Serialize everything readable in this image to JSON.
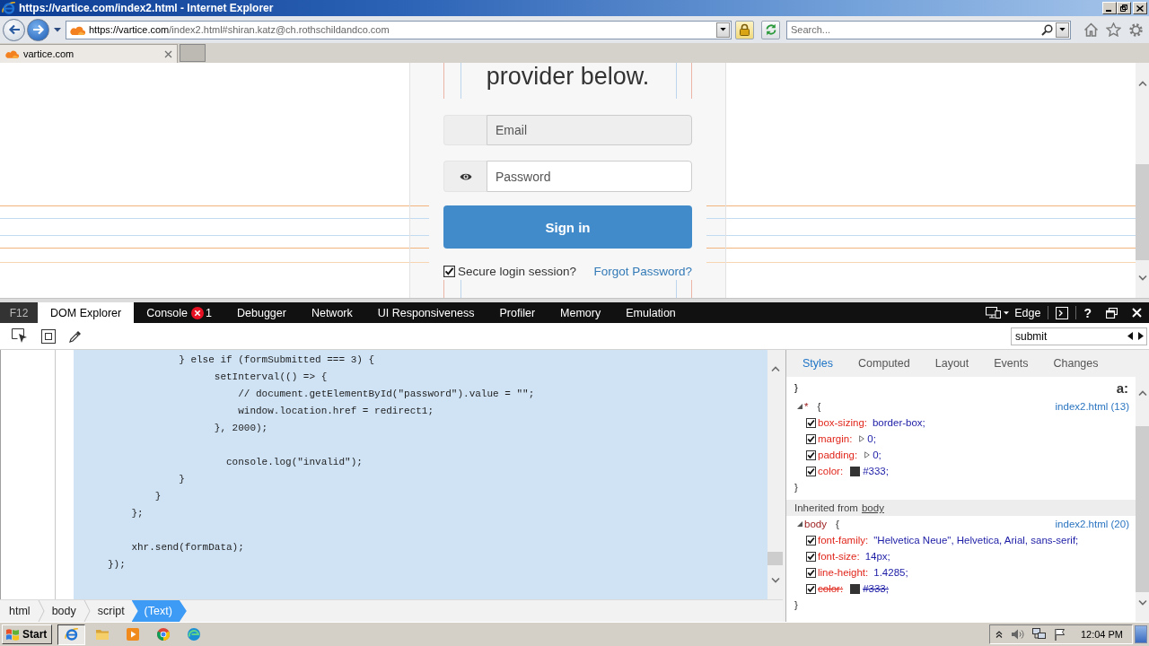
{
  "window": {
    "title": "https://vartice.com/index2.html - Internet Explorer"
  },
  "address_bar": {
    "url_host": "https://vartice.com",
    "url_path": "/index2.html#shiran.katz@ch.rothschildandco.com"
  },
  "search_box": {
    "placeholder": "Search..."
  },
  "tabs": [
    {
      "label": "vartice.com",
      "selected": true
    }
  ],
  "page": {
    "heading": "provider below.",
    "fields": [
      {
        "kind": "email",
        "placeholder": "Email",
        "disabled": true
      },
      {
        "kind": "password",
        "placeholder": "Password",
        "disabled": false
      }
    ],
    "submit_button": "Sign in",
    "secure_session": {
      "label": "Secure login session?",
      "checked": true
    },
    "forgot_link": "Forgot Password?"
  },
  "devtools": {
    "f12_label": "F12",
    "tabs": [
      {
        "label": "DOM Explorer",
        "selected": true
      },
      {
        "label": "Console",
        "selected": false,
        "error_count": "1"
      },
      {
        "label": "Debugger",
        "selected": false
      },
      {
        "label": "Network",
        "selected": false
      },
      {
        "label": "UI Responsiveness",
        "selected": false
      },
      {
        "label": "Profiler",
        "selected": false
      },
      {
        "label": "Memory",
        "selected": false
      },
      {
        "label": "Emulation",
        "selected": false
      }
    ],
    "document_mode": "Edge",
    "help_button": "?",
    "find": {
      "value": "submit"
    },
    "code_blocks": [
      [
        "            } else if (formSubmitted === 3) {",
        "                  setInterval(() => {",
        "                      // document.getElementById(\"password\").value = \"\";",
        "                      window.location.href = redirect1;",
        "                  }, 2000);"
      ],
      [
        "                    console.log(\"invalid\");",
        "            }",
        "        }",
        "    };"
      ],
      [
        "    xhr.send(formData);",
        "});"
      ]
    ],
    "breadcrumb": [
      {
        "label": "html",
        "selected": false
      },
      {
        "label": "body",
        "selected": false
      },
      {
        "label": "script",
        "selected": false
      },
      {
        "label": "(Text)",
        "selected": true
      }
    ],
    "panel_tabs": [
      {
        "label": "Styles",
        "selected": true
      },
      {
        "label": "Computed",
        "selected": false
      },
      {
        "label": "Layout",
        "selected": false
      },
      {
        "label": "Events",
        "selected": false
      },
      {
        "label": "Changes",
        "selected": false
      }
    ],
    "styles": {
      "leading_brace": "}",
      "pseudo_toggle": "a:",
      "sections": [
        {
          "kind": "rule",
          "selector": "*",
          "open_brace": "{",
          "source": "index2.html (13)",
          "expanded": true,
          "properties": [
            {
              "kind": "plain",
              "name": "box-sizing:",
              "value": "border-box;",
              "checked": true,
              "overridden": false
            },
            {
              "kind": "shorthand",
              "name": "margin:",
              "value": "0;",
              "checked": true,
              "overridden": false
            },
            {
              "kind": "shorthand",
              "name": "padding:",
              "value": "0;",
              "checked": true,
              "overridden": false
            },
            {
              "kind": "color",
              "name": "color:",
              "color": "#333333",
              "value": "#333;",
              "checked": true,
              "overridden": false
            }
          ],
          "close_brace": "}"
        },
        {
          "kind": "inherited",
          "label": "Inherited from",
          "source": "body"
        },
        {
          "kind": "rule",
          "selector": "body",
          "open_brace": "{",
          "source": "index2.html (20)",
          "expanded": true,
          "properties": [
            {
              "kind": "plain",
              "name": "font-family:",
              "value": "\"Helvetica Neue\", Helvetica, Arial, sans-serif;",
              "checked": true,
              "overridden": false
            },
            {
              "kind": "plain",
              "name": "font-size:",
              "value": "14px;",
              "checked": true,
              "overridden": false
            },
            {
              "kind": "plain",
              "name": "line-height:",
              "value": "1.4285;",
              "checked": true,
              "overridden": false
            },
            {
              "kind": "color",
              "name": "color:",
              "color": "#333333",
              "value": "#333;",
              "checked": true,
              "overridden": true
            }
          ],
          "close_brace": "}"
        }
      ]
    }
  },
  "taskbar": {
    "start": "Start",
    "clock": "12:04 PM"
  }
}
